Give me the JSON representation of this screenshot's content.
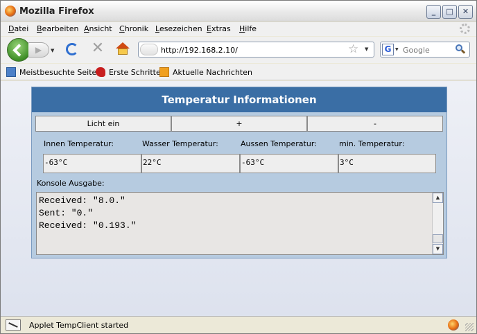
{
  "window": {
    "title": "Mozilla Firefox"
  },
  "menu": [
    "Datei",
    "Bearbeiten",
    "Ansicht",
    "Chronik",
    "Lesezeichen",
    "Extras",
    "Hilfe"
  ],
  "nav": {
    "url": "http://192.168.2.10/",
    "search_placeholder": "Google",
    "search_engine_letter": "G"
  },
  "bookmarks": [
    "Meistbesuchte Seiten",
    "Erste Schritte",
    "Aktuelle Nachrichten"
  ],
  "applet": {
    "title": "Temperatur Informationen",
    "buttons": [
      "Licht ein",
      "+",
      "-"
    ],
    "fields": [
      {
        "label": "Innen Temperatur:",
        "value": "-63°C"
      },
      {
        "label": "Wasser Temperatur:",
        "value": "22°C"
      },
      {
        "label": "Aussen Temperatur:",
        "value": "-63°C"
      },
      {
        "label": "min. Temperatur:",
        "value": "3°C"
      }
    ],
    "console_label": "Konsole Ausgabe:",
    "console_lines": [
      "Received: \"8.0.\"",
      "Sent: \"0.\"",
      "Received: \"0.193.\""
    ]
  },
  "status": {
    "text": "Applet TempClient started"
  }
}
